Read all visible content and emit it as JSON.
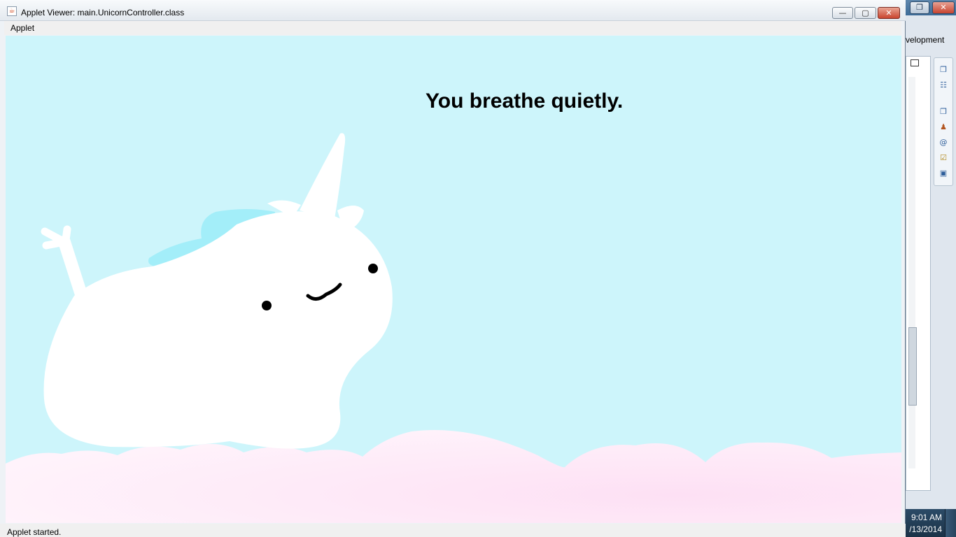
{
  "window": {
    "title": "Applet Viewer: main.UnicornController.class",
    "minimize_label": "—",
    "maximize_label": "▢",
    "close_label": "✕"
  },
  "menu": {
    "items": [
      "Applet"
    ]
  },
  "applet": {
    "message": "You breathe quietly.",
    "colors": {
      "sky": "#cdf5fb",
      "unicorn": "#ffffff",
      "mane": "#a3eef9",
      "clouds": "#fde8f6"
    }
  },
  "status": {
    "text": "Applet started."
  },
  "background_app": {
    "tab_label": "velopment",
    "clock_time": "9:01 AM",
    "clock_date": "/13/2014",
    "icons": [
      "restore-icon",
      "outline-icon",
      "restore-icon",
      "person-icon",
      "at-icon",
      "task-icon",
      "console-icon"
    ]
  }
}
